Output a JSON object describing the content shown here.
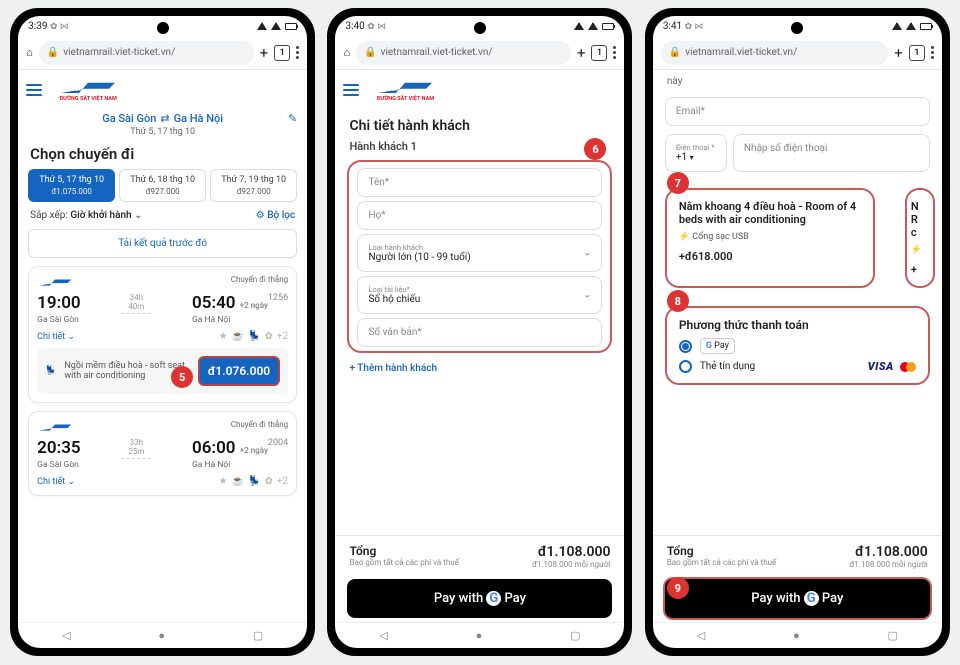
{
  "status": {
    "t1": "3:39",
    "t2": "3:40",
    "t3": "3:41",
    "icons": "✿ ⋈"
  },
  "chrome": {
    "url": "vietnamrail.viet-ticket.vn/",
    "tab_count": "1"
  },
  "logo_sub": "ĐƯỜNG SẮT VIỆT NAM",
  "p1": {
    "from": "Ga Sài Gòn",
    "to": "Ga Hà Nội",
    "date": "Thứ 5, 17 thg 10",
    "h": "Chọn chuyến đi",
    "tabs": [
      {
        "d": "Thứ 5, 17 thg 10",
        "p": "đ1.075.000"
      },
      {
        "d": "Thứ 6, 18 thg 10",
        "p": "đ927.000"
      },
      {
        "d": "Thứ 7, 19 thg 10",
        "p": "đ927.000"
      }
    ],
    "sort_l": "Sắp xếp:",
    "sort_v": "Giờ khởi hành",
    "filter": "Bộ lọc",
    "prev": "Tải kết quả trước đó",
    "direct": "Chuyến đi thẳng",
    "c1": {
      "dep": "19:00",
      "arr": "05:40",
      "dur1": "34h",
      "dur2": "40m",
      "plus": "+2 ngày",
      "code": "1256",
      "from": "Ga Sài Gòn",
      "to": "Ga Hà Nội",
      "details": "Chi tiết",
      "plus2": "+2"
    },
    "seat": "Ngồi mềm điều hoà - soft seat with air conditioning",
    "price": "đ1.076.000",
    "c2": {
      "dep": "20:35",
      "arr": "06:00",
      "dur1": "33h",
      "dur2": "25m",
      "plus": "+2 ngày",
      "code": "2004"
    }
  },
  "p2": {
    "h": "Chi tiết hành khách",
    "sub": "Hành khách 1",
    "f_name": "Tên*",
    "f_surname": "Họ*",
    "f_type_l": "Loại hành khách",
    "f_type_v": "Người lớn (10 - 99 tuổi)",
    "f_doc_l": "Loại tài liệu*",
    "f_doc_v": "Số hộ chiếu",
    "f_docnum": "Số văn bản*",
    "add": "Thêm hành khách",
    "total_l": "Tổng",
    "total_sub": "Bao gồm tất cả các phí và thuế",
    "total_v": "đ1.108.000",
    "per": "đ1.108.000 mỗi người",
    "pay": "Pay with"
  },
  "p3": {
    "prev_line": "này",
    "email": "Email*",
    "phone_l": "Điện thoại *",
    "phone_prefix": "+1",
    "phone_ph": "Nhập số điện thoại",
    "opt_title": "Nằm khoang 4 điều hoà - Room of 4 beds with air conditioning",
    "opt_feat": "Cổng sạc USB",
    "opt_price": "+đ618.000",
    "opt2_hint": "N",
    "opt2_hint2": "R",
    "opt2_hint3": "c",
    "opt2_price": "+",
    "pay_h": "Phương thức thanh toán",
    "m1": "G Pay",
    "m2": "Thẻ tín dụng"
  },
  "badges": {
    "b5": "5",
    "b6": "6",
    "b7": "7",
    "b8": "8",
    "b9": "9"
  }
}
